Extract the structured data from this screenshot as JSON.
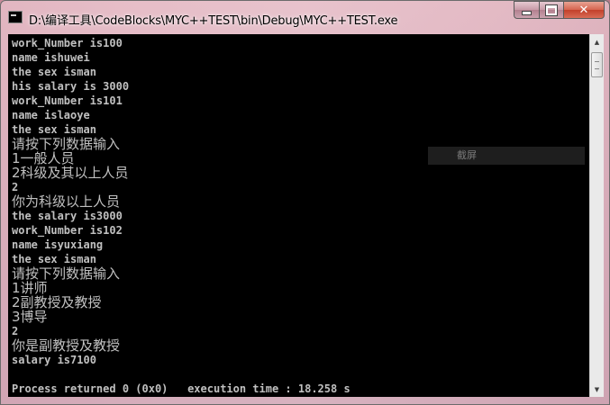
{
  "window": {
    "title": "D:\\编译工具\\CodeBlocks\\MYC++TEST\\bin\\Debug\\MYC++TEST.exe",
    "controls": {
      "minimize": "",
      "maximize": "",
      "close": "✕"
    }
  },
  "console": {
    "lines": [
      "work_Number is100",
      "name ishuwei",
      "the sex isman",
      "his salary is 3000",
      "work_Number is101",
      "name islaoye",
      "the sex isman",
      "请按下列数据输入",
      "1一般人员",
      "2科级及其以上人员",
      "2",
      "你为科级以上人员",
      "the salary is3000",
      "work_Number is102",
      "name isyuxiang",
      "the sex isman",
      "请按下列数据输入",
      "1讲师",
      "2副教授及教授",
      "3博导",
      "2",
      "你是副教授及教授",
      "salary is7100",
      "",
      "Process returned 0 (0x0)   execution time : 18.258 s"
    ]
  },
  "overlay": {
    "screenshot_label": "截屏"
  },
  "scrollbar": {
    "up_arrow": "▲",
    "down_arrow": "▼"
  },
  "colors": {
    "console_bg": "#000000",
    "console_text": "#c0c0c0",
    "close_button": "#c2402a"
  }
}
